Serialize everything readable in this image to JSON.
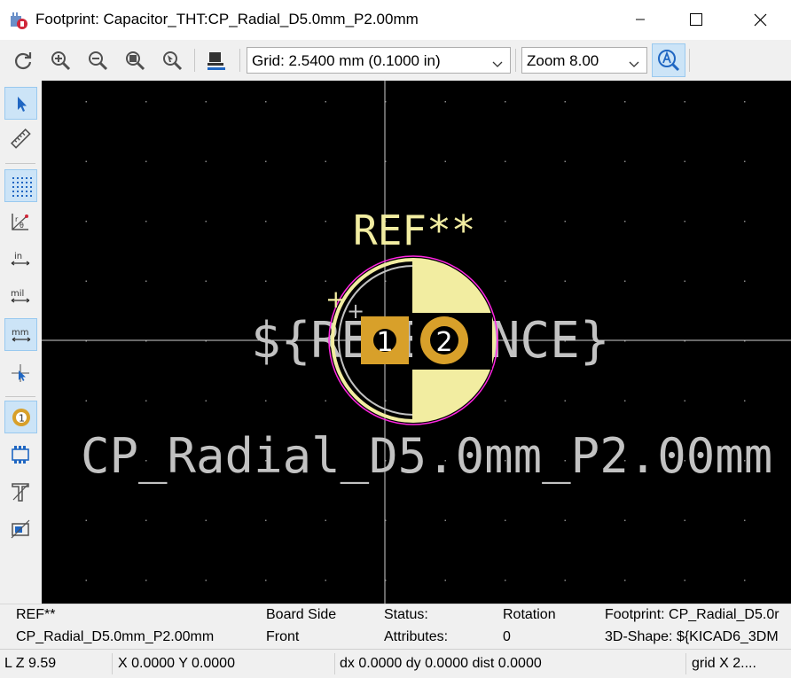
{
  "window": {
    "title": "Footprint: Capacitor_THT:CP_Radial_D5.0mm_P2.00mm"
  },
  "toolbar": {
    "grid_value": "Grid: 2.5400 mm (0.1000 in)",
    "zoom_value": "Zoom 8.00"
  },
  "canvas": {
    "ref_text": "REF**",
    "ref_placeholder": "${REFERENCE}",
    "value_text": "CP_Radial_D5.0mm_P2.00mm",
    "pad1": "1",
    "pad2": "2",
    "plus_mark": "+",
    "colors": {
      "background": "#000000",
      "silkscreen": "#f2eda1",
      "fab": "#c2c2c2",
      "courtyard": "#ff26e2",
      "pad": "#d8a02a"
    }
  },
  "message_panel": {
    "ref": "REF**",
    "name": "CP_Radial_D5.0mm_P2.00mm",
    "board_side_label": "Board Side",
    "board_side_value": "Front",
    "status_label": "Status:",
    "attributes_label": "Attributes:",
    "rotation_label": "Rotation",
    "rotation_value": "0",
    "footprint_label": "Footprint: CP_Radial_D5.0r",
    "shape_label": "3D-Shape: ${KICAD6_3DM"
  },
  "status_bar": {
    "zoom": "Z 9.59",
    "xy": "X 0.0000  Y 0.0000",
    "dxdy": "dx 0.0000  dy 0.0000  dist 0.0000",
    "grid": "grid X 2...."
  }
}
